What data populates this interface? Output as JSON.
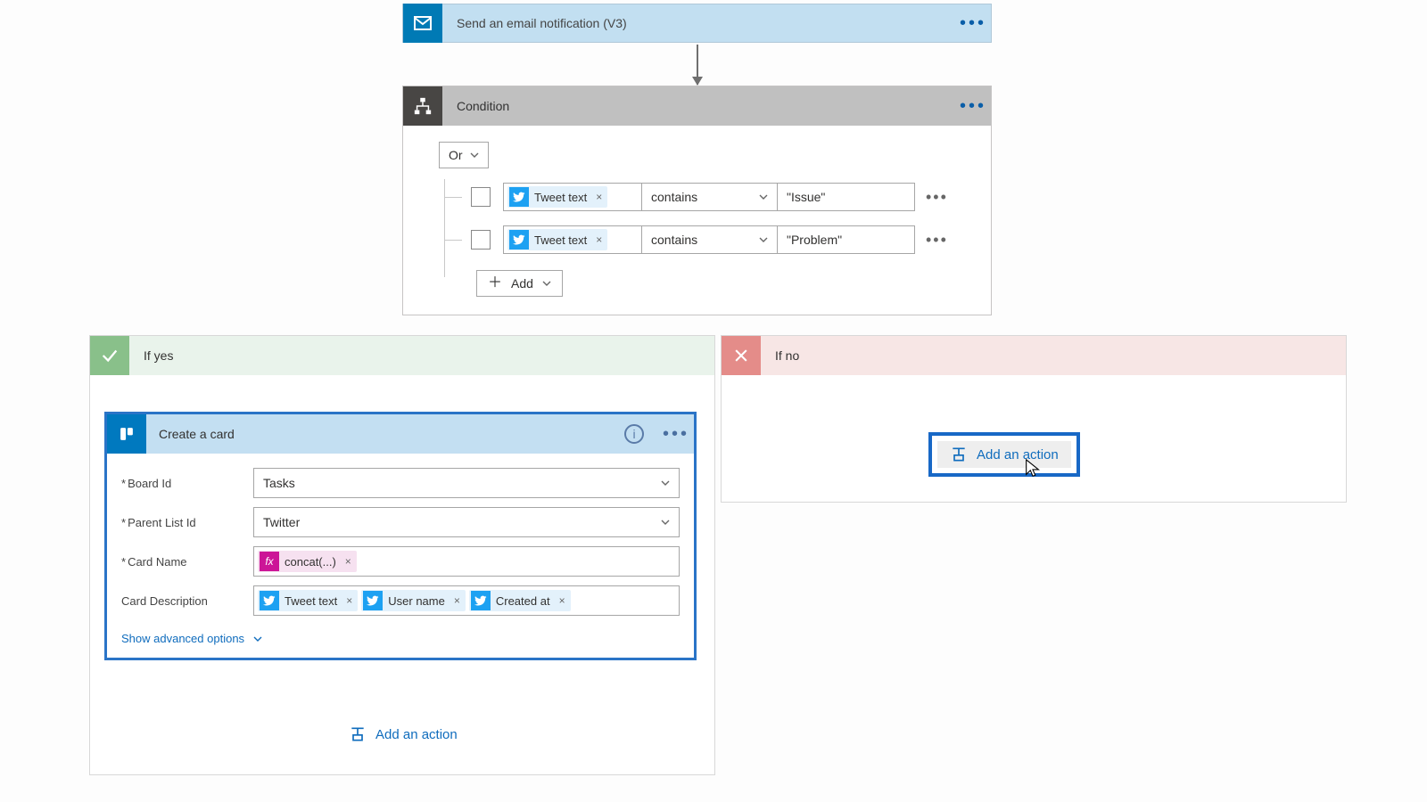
{
  "email": {
    "title": "Send an email notification (V3)"
  },
  "condition": {
    "title": "Condition",
    "group_operator": "Or",
    "rows": [
      {
        "token_label": "Tweet text",
        "operator": "contains",
        "value": "\"Issue\""
      },
      {
        "token_label": "Tweet text",
        "operator": "contains",
        "value": "\"Problem\""
      }
    ],
    "add_label": "Add"
  },
  "if_yes": {
    "title": "If yes",
    "card_title": "Create a card",
    "fields": {
      "board_id_label": "Board Id",
      "board_id_value": "Tasks",
      "parent_list_label": "Parent List Id",
      "parent_list_value": "Twitter",
      "card_name_label": "Card Name",
      "card_name_token": "concat(...)",
      "card_desc_label": "Card Description",
      "card_desc_tokens": [
        "Tweet text",
        "User name",
        "Created at"
      ],
      "show_advanced": "Show advanced options"
    },
    "add_action": "Add an action"
  },
  "if_no": {
    "title": "If no",
    "add_action": "Add an action"
  }
}
